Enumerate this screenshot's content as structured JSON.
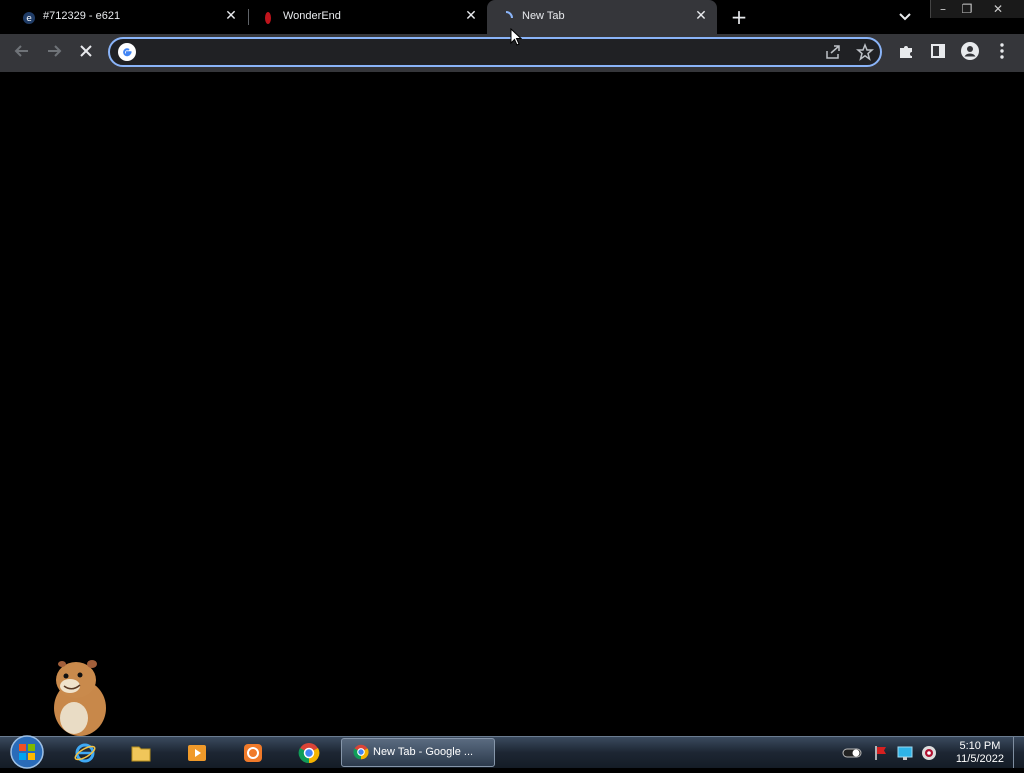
{
  "tabs": [
    {
      "title": "#712329 - e621",
      "favicon": "e621-favicon-icon",
      "close": "✕"
    },
    {
      "title": "WonderEnd",
      "favicon": "wonderend-favicon-icon",
      "close": "✕"
    },
    {
      "title": "New Tab",
      "favicon": "loading-spinner-icon",
      "close": "✕",
      "active": true
    }
  ],
  "new_tab_symbol": "+",
  "window_controls": {
    "minimize": "–",
    "restore": "❐",
    "close": "✕"
  },
  "toolbar": {
    "back_icon": "back-arrow-icon",
    "forward_icon": "forward-arrow-icon",
    "stop_icon": "stop-x-icon"
  },
  "omnibox": {
    "value": "",
    "placeholder": ""
  },
  "taskbar": {
    "active_task_label": "New Tab - Google ...",
    "clock_time": "5:10 PM",
    "clock_date": "11/5/2022"
  },
  "colors": {
    "accent": "#8ab4f8",
    "toolbar": "#35363a",
    "page": "#000000"
  }
}
